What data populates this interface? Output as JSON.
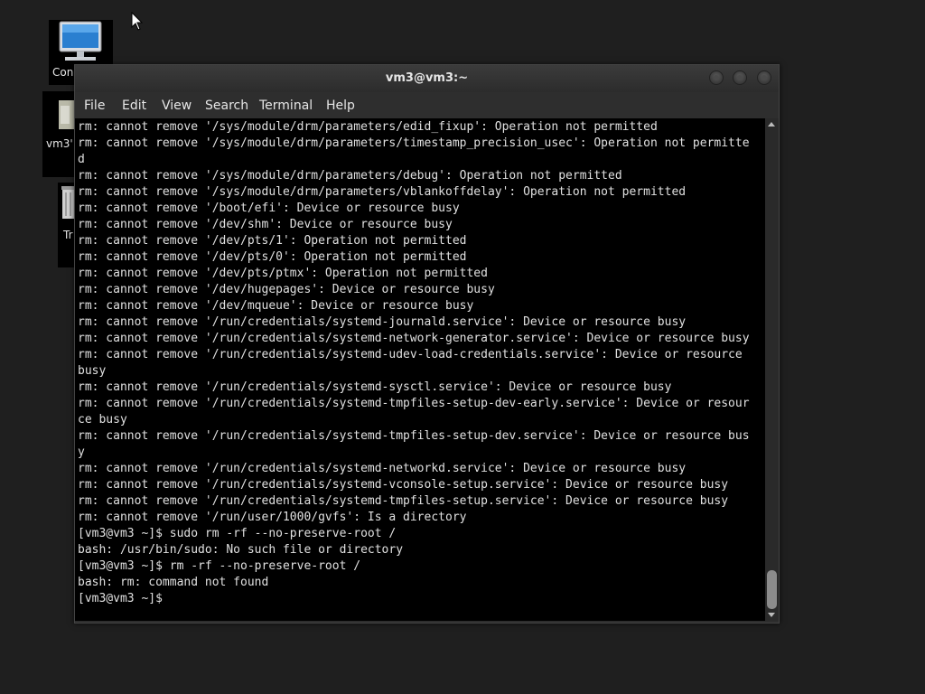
{
  "desktop": {
    "icons": [
      {
        "label": "Con"
      },
      {
        "label": "vm3'"
      },
      {
        "label": "Tr"
      }
    ]
  },
  "window": {
    "title": "vm3@vm3:~"
  },
  "menu": {
    "file": "File",
    "edit": "Edit",
    "view": "View",
    "search": "Search",
    "terminal": "Terminal",
    "help": "Help"
  },
  "terminal": {
    "lines": [
      "rm: cannot remove '/sys/module/drm/parameters/edid_fixup': Operation not permitted",
      "rm: cannot remove '/sys/module/drm/parameters/timestamp_precision_usec': Operation not permitte",
      "d",
      "rm: cannot remove '/sys/module/drm/parameters/debug': Operation not permitted",
      "rm: cannot remove '/sys/module/drm/parameters/vblankoffdelay': Operation not permitted",
      "rm: cannot remove '/boot/efi': Device or resource busy",
      "rm: cannot remove '/dev/shm': Device or resource busy",
      "rm: cannot remove '/dev/pts/1': Operation not permitted",
      "rm: cannot remove '/dev/pts/0': Operation not permitted",
      "rm: cannot remove '/dev/pts/ptmx': Operation not permitted",
      "rm: cannot remove '/dev/hugepages': Device or resource busy",
      "rm: cannot remove '/dev/mqueue': Device or resource busy",
      "rm: cannot remove '/run/credentials/systemd-journald.service': Device or resource busy",
      "rm: cannot remove '/run/credentials/systemd-network-generator.service': Device or resource busy",
      "rm: cannot remove '/run/credentials/systemd-udev-load-credentials.service': Device or resource",
      "busy",
      "rm: cannot remove '/run/credentials/systemd-sysctl.service': Device or resource busy",
      "rm: cannot remove '/run/credentials/systemd-tmpfiles-setup-dev-early.service': Device or resour",
      "ce busy",
      "rm: cannot remove '/run/credentials/systemd-tmpfiles-setup-dev.service': Device or resource bus",
      "y",
      "rm: cannot remove '/run/credentials/systemd-networkd.service': Device or resource busy",
      "rm: cannot remove '/run/credentials/systemd-vconsole-setup.service': Device or resource busy",
      "rm: cannot remove '/run/credentials/systemd-tmpfiles-setup.service': Device or resource busy",
      "rm: cannot remove '/run/user/1000/gvfs': Is a directory",
      "[vm3@vm3 ~]$ sudo rm -rf --no-preserve-root /",
      "bash: /usr/bin/sudo: No such file or directory",
      "[vm3@vm3 ~]$ rm -rf --no-preserve-root /",
      "bash: rm: command not found",
      "[vm3@vm3 ~]$"
    ]
  }
}
